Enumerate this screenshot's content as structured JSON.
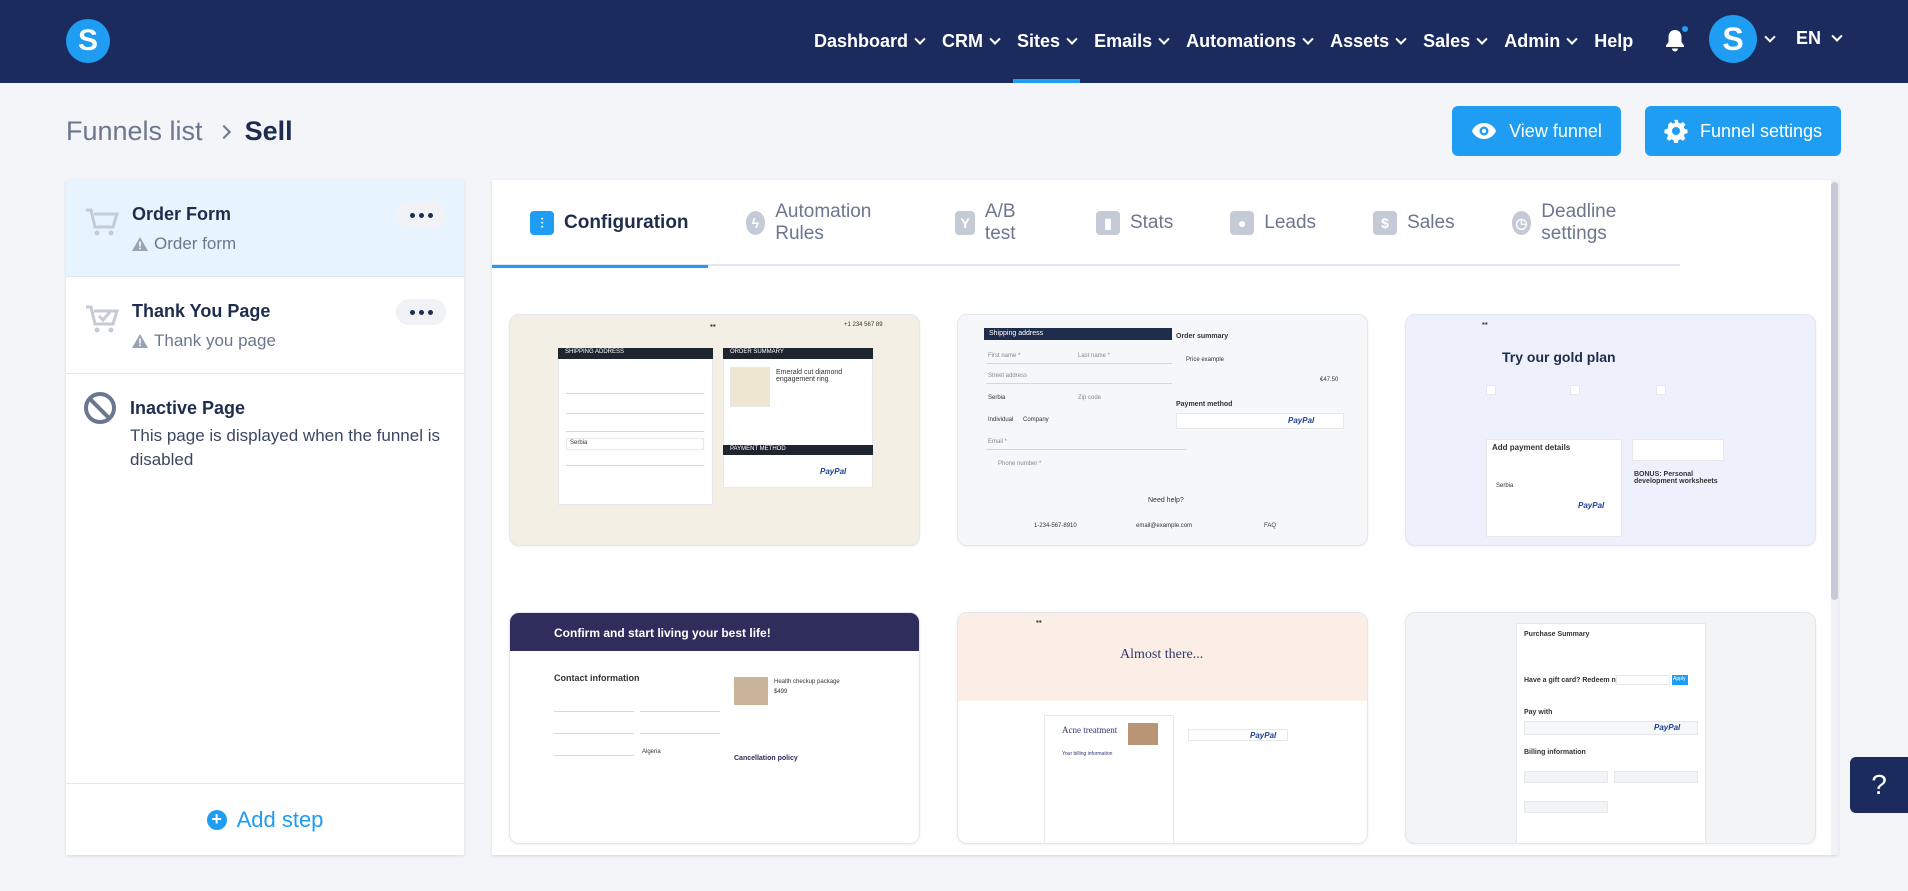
{
  "brand": {
    "logo_letter": "S",
    "accent": "#1e9df2",
    "nav_bg": "#1b2b5e"
  },
  "nav": {
    "items": [
      {
        "label": "Dashboard",
        "has_menu": true
      },
      {
        "label": "CRM",
        "has_menu": true
      },
      {
        "label": "Sites",
        "has_menu": true,
        "active": true
      },
      {
        "label": "Emails",
        "has_menu": true
      },
      {
        "label": "Automations",
        "has_menu": true
      },
      {
        "label": "Assets",
        "has_menu": true
      },
      {
        "label": "Sales",
        "has_menu": true
      },
      {
        "label": "Admin",
        "has_menu": true
      },
      {
        "label": "Help",
        "has_menu": false
      }
    ],
    "avatar_letter": "S",
    "language": "EN"
  },
  "breadcrumb": {
    "parent": "Funnels list",
    "current": "Sell"
  },
  "actions": {
    "view_funnel": "View funnel",
    "funnel_settings": "Funnel settings"
  },
  "steps": [
    {
      "title": "Order Form",
      "subtitle": "Order form",
      "icon": "cart-icon"
    },
    {
      "title": "Thank You Page",
      "subtitle": "Thank you page",
      "icon": "cart-check-icon"
    }
  ],
  "inactive_page": {
    "title": "Inactive Page",
    "description": "This page is displayed when the funnel is disabled"
  },
  "add_step": "Add step",
  "tabs": [
    {
      "label": "Configuration",
      "icon": "sliders-icon",
      "active": true
    },
    {
      "label": "Automation Rules",
      "icon": "lightning-icon"
    },
    {
      "label": "A/B test",
      "icon": "split-icon"
    },
    {
      "label": "Stats",
      "icon": "bar-chart-icon"
    },
    {
      "label": "Leads",
      "icon": "users-icon"
    },
    {
      "label": "Sales",
      "icon": "dollar-icon"
    },
    {
      "label": "Deadline settings",
      "icon": "clock-icon"
    }
  ],
  "templates": {
    "t1": {
      "shipping": "SHIPPING ADDRESS",
      "summary": "ORDER SUMMARY",
      "product": "Emerald cut diamond engagement ring",
      "payment": "PAYMENT METHOD",
      "phone": "+1 234 567 89",
      "country": "Serbia",
      "paypal": "PayPal"
    },
    "t2": {
      "shipping": "Shipping address",
      "summary": "Order summary",
      "first": "First name *",
      "last": "Last name *",
      "street": "Street address",
      "country": "Serbia",
      "zip": "Zip code",
      "individual": "Individual",
      "company": "Company",
      "email": "Email *",
      "phone": "Phone number *",
      "payment": "Payment method",
      "paypal": "PayPal",
      "help": "Need help?",
      "phone_num": "1-234-567-8910",
      "mail": "email@example.com",
      "faq": "FAQ",
      "price_example": "Price example",
      "price_val": "€47.50"
    },
    "t3": {
      "headline": "Try our gold plan",
      "pay_details": "Add payment details",
      "bonus": "BONUS: Personal development worksheets",
      "country": "Serbia",
      "paypal": "PayPal"
    },
    "t4": {
      "header": "Confirm and start living your best life!",
      "contact": "Contact information",
      "product": "Health checkup package",
      "price": "$499",
      "cancel": "Cancellation policy",
      "country": "Algeria"
    },
    "t5": {
      "headline": "Almost there...",
      "product": "Acne treatment",
      "paypal": "PayPal",
      "billing": "Your billing information"
    },
    "t6": {
      "summary": "Purchase Summary",
      "gift": "Have a gift card? Redeem now",
      "apply": "Apply",
      "pay_with": "Pay with",
      "billing": "Billing information",
      "paypal": "PayPal"
    }
  }
}
